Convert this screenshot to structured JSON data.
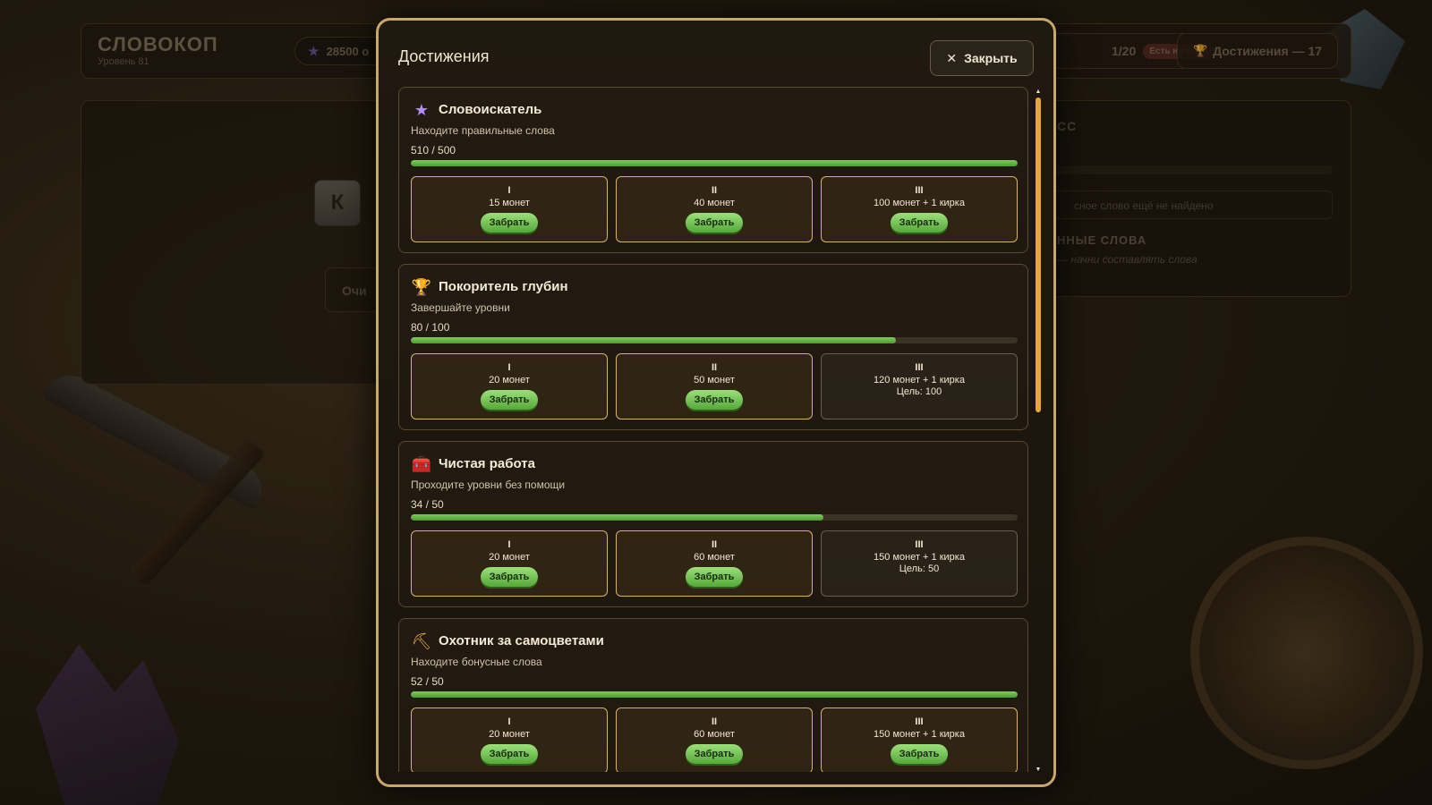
{
  "app": {
    "title": "СЛОВОКОП",
    "level": "Уровень 81",
    "coins": "28500 о",
    "progress_text": "1/20",
    "reward_badge": "Есть награда",
    "achievements_button": "Достижения — 17"
  },
  "board": {
    "letter": "К",
    "clear_label": "Очи"
  },
  "side_panel": {
    "title": "СС",
    "note": "сное слово ещё не найдено",
    "found_title": "ННЫЕ СЛОВА",
    "found_note": "— начни составлять слова"
  },
  "modal": {
    "title": "Достижения",
    "close_label": "Закрыть",
    "claim_label": "Забрать",
    "achievements": [
      {
        "icon": "star-icon",
        "title": "Словоискатель",
        "desc": "Находите правильные слова",
        "progress": "510 / 500",
        "fill": 1.0,
        "tiers": [
          {
            "num": "I",
            "reward": "15 монет",
            "state": "claim"
          },
          {
            "num": "II",
            "reward": "40 монет",
            "state": "claim"
          },
          {
            "num": "III",
            "reward": "100 монет + 1 кирка",
            "state": "claim"
          }
        ]
      },
      {
        "icon": "trophy-icon",
        "title": "Покоритель глубин",
        "desc": "Завершайте уровни",
        "progress": "80 / 100",
        "fill": 0.8,
        "tiers": [
          {
            "num": "I",
            "reward": "20 монет",
            "state": "claim"
          },
          {
            "num": "II",
            "reward": "50 монет",
            "state": "claim"
          },
          {
            "num": "III",
            "reward": "120 монет + 1 кирка",
            "goal": "Цель: 100",
            "state": "locked"
          }
        ]
      },
      {
        "icon": "chest-icon",
        "title": "Чистая работа",
        "desc": "Проходите уровни без помощи",
        "progress": "34 / 50",
        "fill": 0.68,
        "tiers": [
          {
            "num": "I",
            "reward": "20 монет",
            "state": "claim"
          },
          {
            "num": "II",
            "reward": "60 монет",
            "state": "claim"
          },
          {
            "num": "III",
            "reward": "150 монет + 1 кирка",
            "goal": "Цель: 50",
            "state": "locked"
          }
        ]
      },
      {
        "icon": "pickaxe-icon",
        "title": "Охотник за самоцветами",
        "desc": "Находите бонусные слова",
        "progress": "52 / 50",
        "fill": 1.0,
        "tiers": [
          {
            "num": "I",
            "reward": "20 монет",
            "state": "claim"
          },
          {
            "num": "II",
            "reward": "60 монет",
            "state": "claim"
          },
          {
            "num": "III",
            "reward": "150 монет + 1 кирка",
            "state": "claim"
          }
        ]
      }
    ]
  }
}
